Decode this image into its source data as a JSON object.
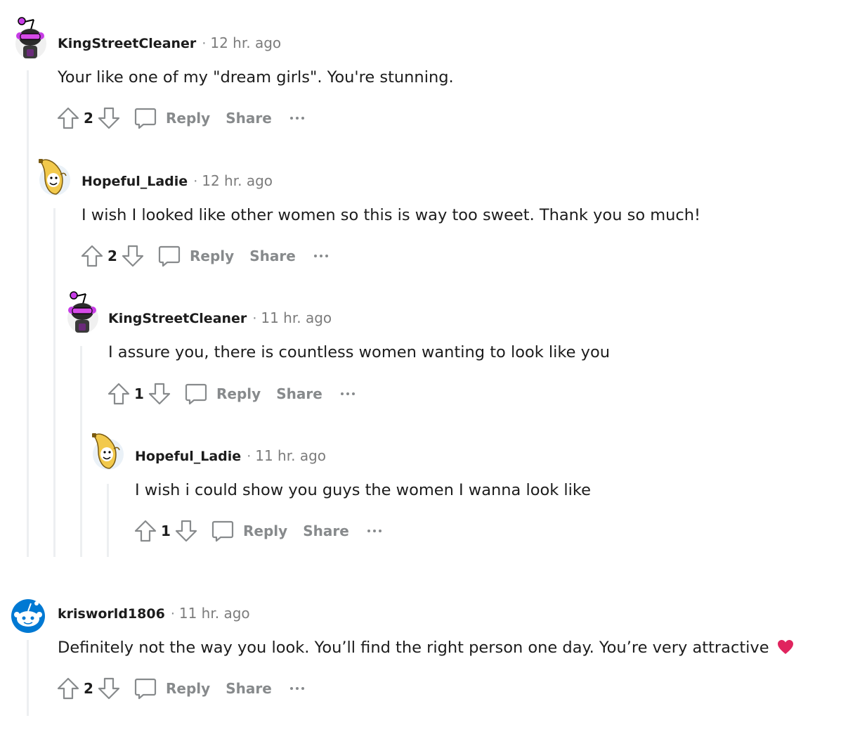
{
  "colors": {
    "thread_line": "#edeff1",
    "meta": "#878a8c",
    "heart": "#e0245e"
  },
  "comments": [
    {
      "author": "KingStreetCleaner",
      "time": "12 hr. ago",
      "body": "Your like one of my \"dream girls\". You're stunning.",
      "score": "2",
      "avatar": "snoo-purple-sunglasses-icon"
    },
    {
      "author": "Hopeful_Ladie",
      "time": "12 hr. ago",
      "body": "I wish I looked like other women so this is way too sweet. Thank you so much!",
      "score": "2",
      "avatar": "banana-snoo-icon"
    },
    {
      "author": "KingStreetCleaner",
      "time": "11 hr. ago",
      "body": "I assure you, there is countless women wanting to look like you",
      "score": "1",
      "avatar": "snoo-purple-sunglasses-icon"
    },
    {
      "author": "Hopeful_Ladie",
      "time": "11 hr. ago",
      "body": "I wish i could show you guys the women I wanna look like",
      "score": "1",
      "avatar": "banana-snoo-icon"
    },
    {
      "author": "krisworld1806",
      "time": "11 hr. ago",
      "body": "Definitely not the way you look. You’ll find the right person one day. You’re very attractive",
      "score": "2",
      "avatar": "default-snoo-icon"
    }
  ],
  "actions": {
    "reply": "Reply",
    "share": "Share",
    "dot": "·"
  }
}
